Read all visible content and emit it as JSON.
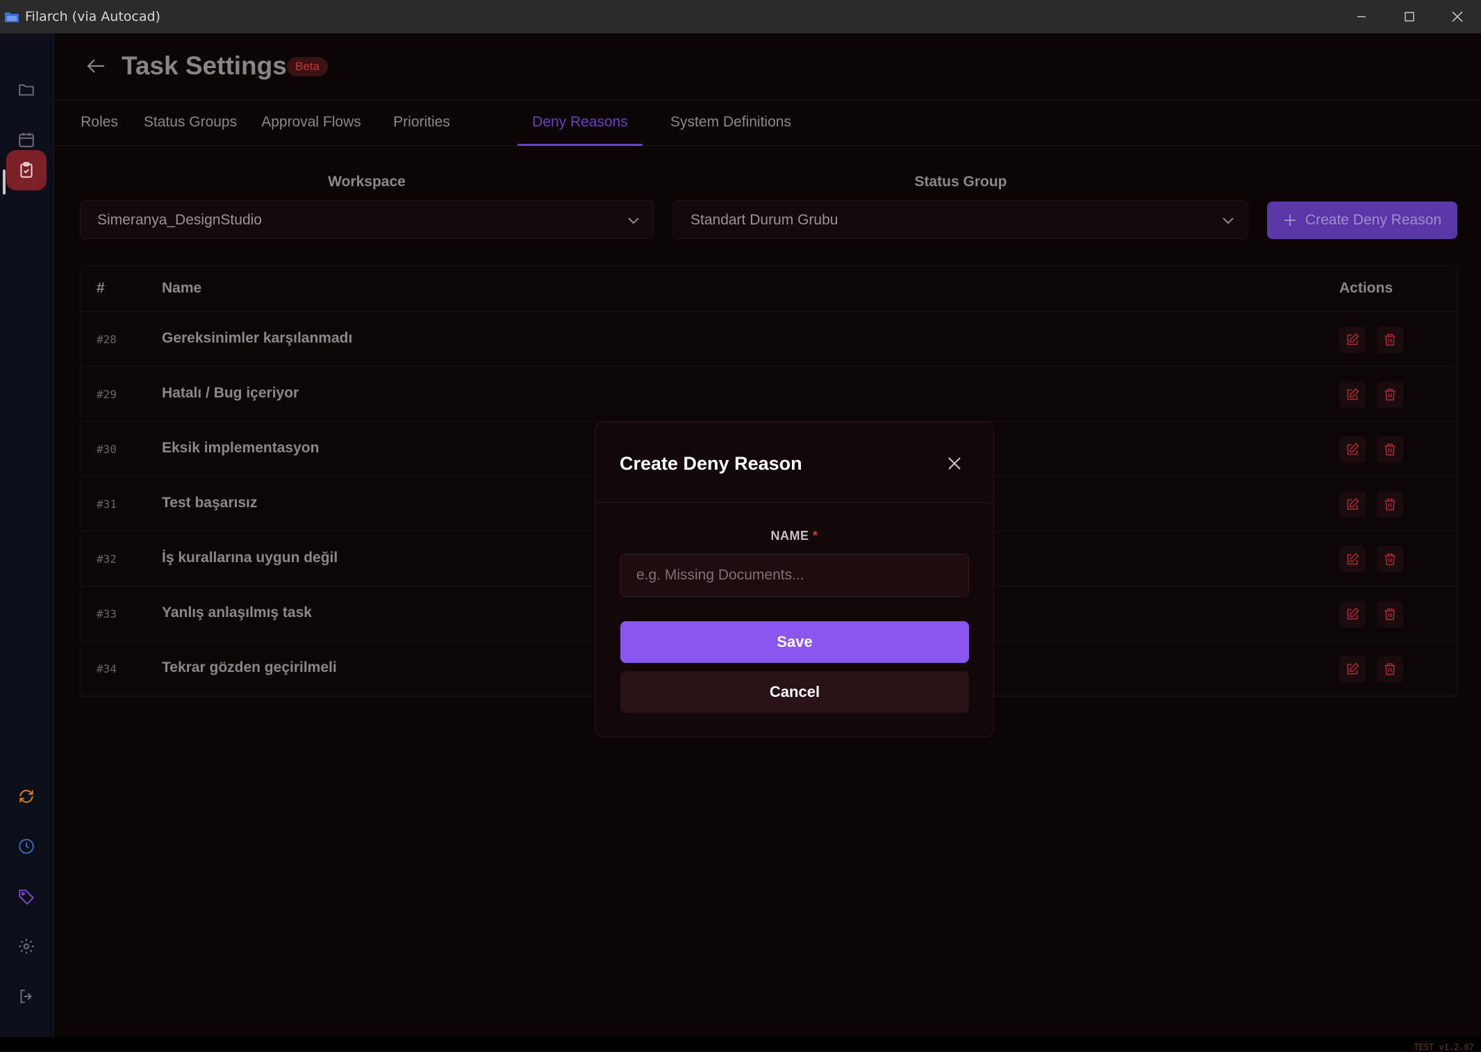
{
  "window": {
    "title": "Filarch (via Autocad)"
  },
  "header": {
    "title": "Task Settings",
    "badge": "Beta"
  },
  "tabs": [
    {
      "label": "Roles"
    },
    {
      "label": "Status Groups"
    },
    {
      "label": "Approval Flows"
    },
    {
      "label": "Priorities"
    },
    {
      "label": "Deny Reasons",
      "active": true
    },
    {
      "label": "System Definitions"
    }
  ],
  "filters": {
    "workspace_label": "Workspace",
    "workspace_value": "Simeranya_DesignStudio",
    "status_group_label": "Status Group",
    "status_group_value": "Standart Durum Grubu"
  },
  "create_button_label": "Create Deny Reason",
  "table": {
    "columns": [
      "#",
      "Name",
      "Actions"
    ],
    "rows": [
      {
        "id": "#28",
        "name": "Gereksinimler karşılanmadı"
      },
      {
        "id": "#29",
        "name": "Hatalı / Bug içeriyor"
      },
      {
        "id": "#30",
        "name": "Eksik implementasyon"
      },
      {
        "id": "#31",
        "name": "Test başarısız"
      },
      {
        "id": "#32",
        "name": "İş kurallarına uygun değil"
      },
      {
        "id": "#33",
        "name": "Yanlış anlaşılmış task"
      },
      {
        "id": "#34",
        "name": "Tekrar gözden geçirilmeli"
      }
    ]
  },
  "modal": {
    "title": "Create Deny Reason",
    "name_label": "NAME",
    "required_mark": "*",
    "name_placeholder": "e.g. Missing Documents...",
    "name_value": "",
    "save_label": "Save",
    "cancel_label": "Cancel"
  },
  "footer": {
    "build_tag": "TEST v1.2.87"
  },
  "colors": {
    "accent": "#8b55f0",
    "danger": "#c2363d",
    "sidebar_active": "#7c1f27"
  }
}
